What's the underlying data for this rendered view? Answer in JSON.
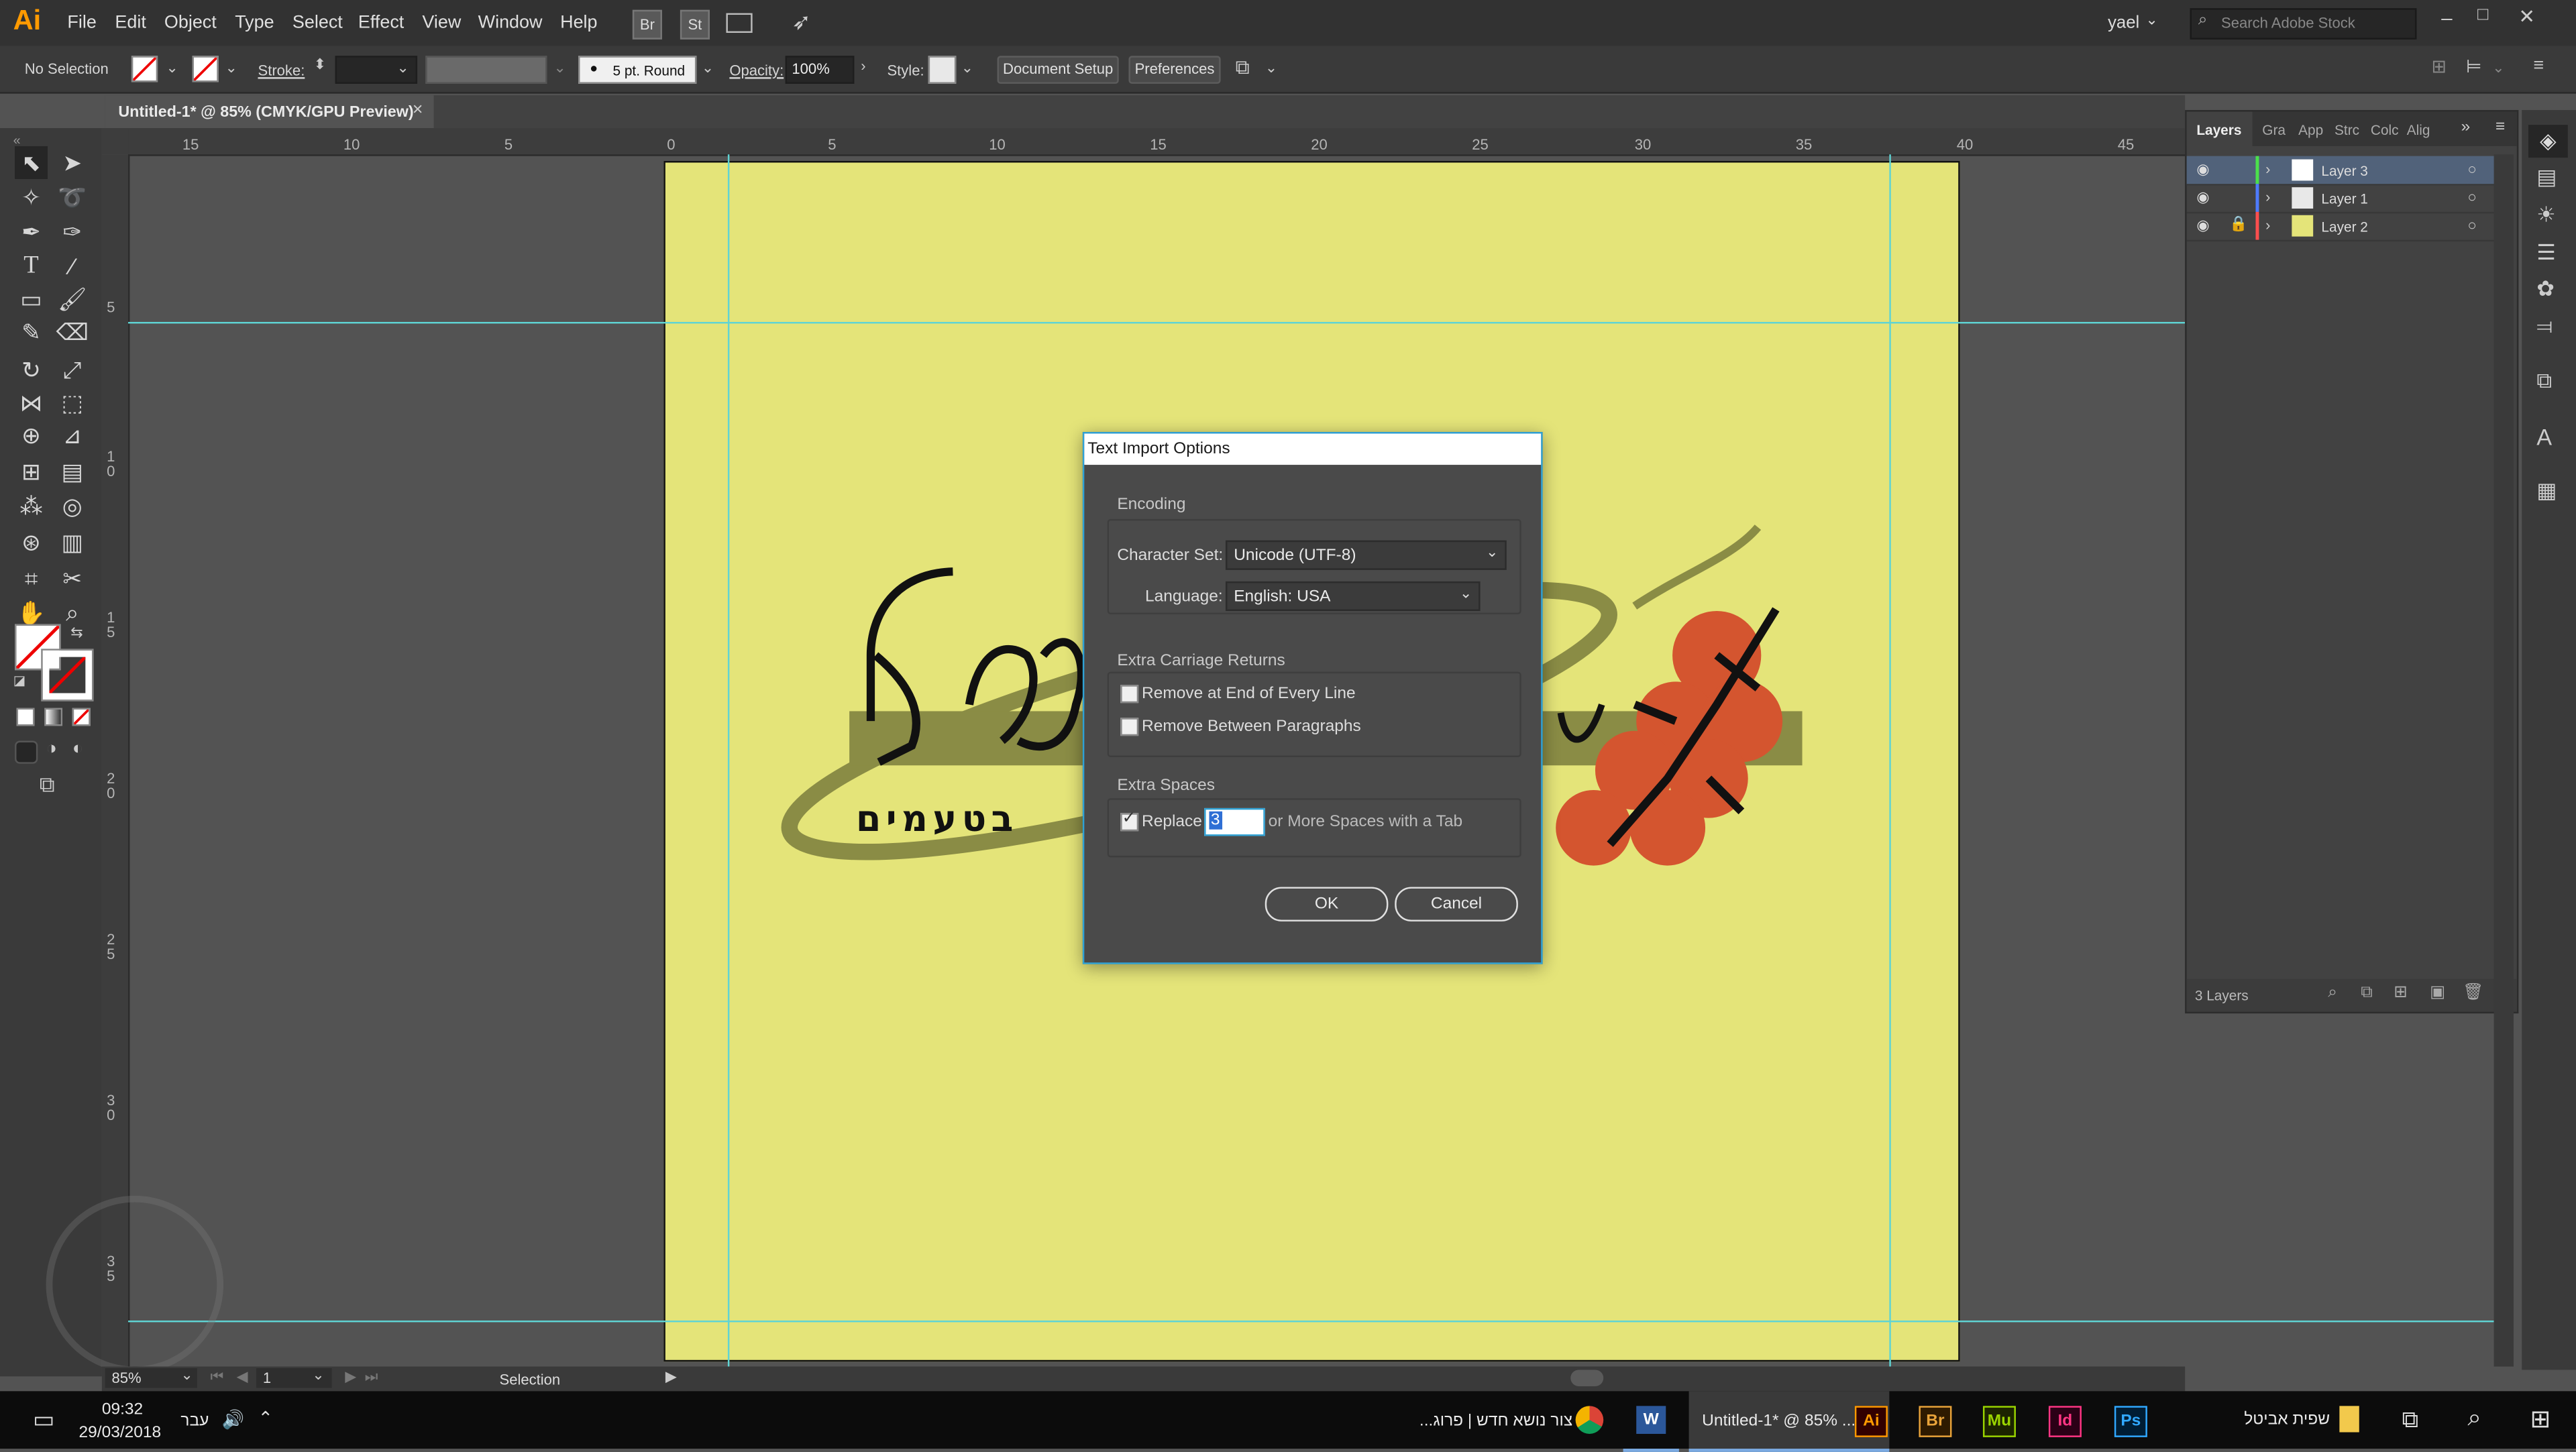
{
  "menubar": {
    "logo": "Ai",
    "items": [
      "File",
      "Edit",
      "Object",
      "Type",
      "Select",
      "Effect",
      "View",
      "Window",
      "Help"
    ],
    "bridge": "Br",
    "stock": "St",
    "user": "yael",
    "search_placeholder": "Search Adobe Stock"
  },
  "controlbar": {
    "selection": "No Selection",
    "stroke_label": "Stroke:",
    "brush": "5 pt. Round",
    "opacity_label": "Opacity:",
    "opacity_value": "100%",
    "style_label": "Style:",
    "document_setup": "Document Setup",
    "preferences": "Preferences"
  },
  "document": {
    "tab_title": "Untitled-1* @ 85% (CMYK/GPU Preview)",
    "close": "×"
  },
  "ruler_h": [
    "15",
    "10",
    "5",
    "0",
    "5",
    "10",
    "15",
    "20",
    "25",
    "30",
    "35",
    "40",
    "45"
  ],
  "ruler_v": [
    "5",
    "1\n0",
    "1\n5",
    "2\n0",
    "2\n5",
    "3\n0",
    "3\n5"
  ],
  "artwork": {
    "hebrew_sub": "בטעמים"
  },
  "dialog": {
    "title": "Text Import Options",
    "encoding_label": "Encoding",
    "charset_label": "Character Set:",
    "charset_value": "Unicode (UTF-8)",
    "language_label": "Language:",
    "language_value": "English: USA",
    "ecr_label": "Extra Carriage Returns",
    "remove_end_line": "Remove at End of Every Line",
    "remove_between": "Remove Between Paragraphs",
    "extra_spaces_label": "Extra Spaces",
    "replace_label": "Replace",
    "replace_value": "3",
    "replace_suffix": "or More Spaces with a Tab",
    "ok": "OK",
    "cancel": "Cancel"
  },
  "layers_panel": {
    "tabs": [
      "Layers",
      "Gra",
      "App",
      "Strc",
      "Colc",
      "Alig"
    ],
    "layers": [
      {
        "name": "Layer 3",
        "color": "#4be04b"
      },
      {
        "name": "Layer 1",
        "color": "#4e7bff"
      },
      {
        "name": "Layer 2",
        "color": "#ff4e4e"
      }
    ],
    "count": "3 Layers"
  },
  "statusbar": {
    "zoom": "85%",
    "page": "1",
    "mode": "Selection"
  },
  "taskbar": {
    "time": "09:32",
    "date": "29/03/2018",
    "lang": "עבר",
    "chrome_title": "צור נושא חדש | פרוג...",
    "ai_title": "Untitled-1* @ 85% ...",
    "user_name": "שפית אביטל",
    "apps": [
      "W",
      "Ai",
      "Br",
      "Mu",
      "Id",
      "Ps"
    ]
  },
  "colors": {
    "artboard": "#e4e479",
    "guide": "#5fd4d4",
    "dialog_border": "#2fa2d5",
    "ai_orange": "#ff9a00"
  }
}
